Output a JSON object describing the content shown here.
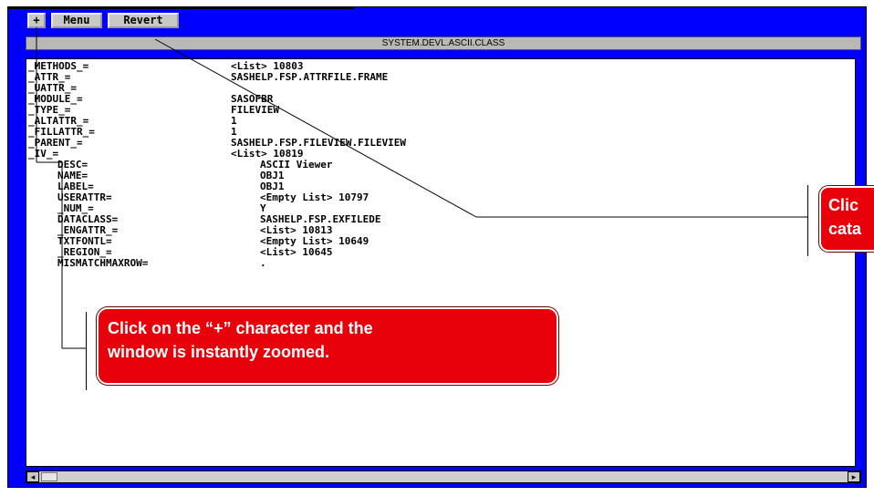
{
  "toolbar": {
    "zoom_label": "+",
    "menu_label": "Menu",
    "revert_label": "Revert"
  },
  "window": {
    "title": "SYSTEM.DEVL.ASCII.CLASS"
  },
  "attributes": [
    {
      "name": "_METHODS_=",
      "value": "<List> 10803"
    },
    {
      "name": "_ATTR_=",
      "value": "SASHELP.FSP.ATTRFILE.FRAME"
    },
    {
      "name": "_UATTR_=",
      "value": ""
    },
    {
      "name": "_MODULE_=",
      "value": "SASOFBR"
    },
    {
      "name": "_TYPE_=",
      "value": "FILEVIEW"
    },
    {
      "name": "_ALTATTR_=",
      "value": "1"
    },
    {
      "name": "_FILLATTR_=",
      "value": "1"
    },
    {
      "name": "_PARENT_=",
      "value": "SASHELP.FSP.FILEVIEW.FILEVIEW"
    },
    {
      "name": "_IV_=",
      "value": "<List> 10819"
    },
    {
      "name": "DESC=",
      "value": "ASCII Viewer"
    },
    {
      "name": "NAME=",
      "value": "OBJ1"
    },
    {
      "name": "LABEL=",
      "value": "OBJ1"
    },
    {
      "name": "USERATTR=",
      "value": "<Empty List> 10797"
    },
    {
      "name": "_NUM_=",
      "value": "Y"
    },
    {
      "name": "DATACLASS=",
      "value": "SASHELP.FSP.EXFILEDE"
    },
    {
      "name": "_ENGATTR_=",
      "value": "<List> 10813"
    },
    {
      "name": "TXTFONTL=",
      "value": "<Empty List> 10649"
    },
    {
      "name": "_REGION_=",
      "value": "<List> 10645"
    },
    {
      "name": "MISMATCHMAXROW=",
      "value": "."
    }
  ],
  "scrollbar": {
    "left_arrow": "◂",
    "right_arrow": "▸"
  },
  "callouts": {
    "zoom_line1": "Click on the “+” character and the",
    "zoom_line2": "window is instantly zoomed.",
    "right_line1": "Clic",
    "right_line2": "cata"
  },
  "colors": {
    "window_background": "#0000fe",
    "callout_fill": "#e8000a"
  }
}
